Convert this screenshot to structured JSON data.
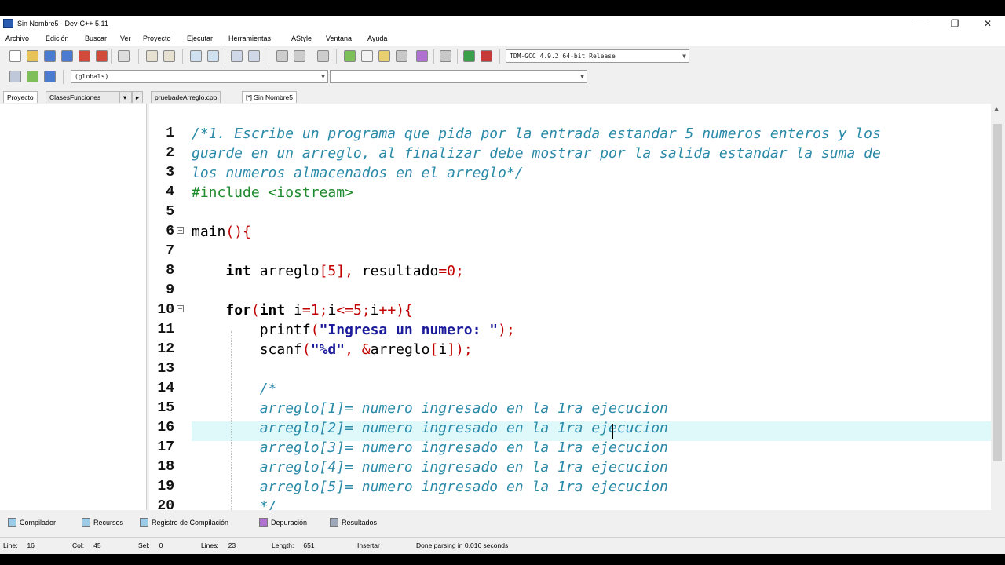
{
  "window": {
    "title": "Sin Nombre5 - Dev-C++ 5.11",
    "minimize": "—",
    "maximize": "❐",
    "close": "✕"
  },
  "menu": [
    "Archivo",
    "Edición",
    "Buscar",
    "Ver",
    "Proyecto",
    "Ejecutar",
    "Herramientas",
    "AStyle",
    "Ventana",
    "Ayuda"
  ],
  "toolbar": {
    "compiler_select": "TDM-GCC 4.9.2 64-bit Release",
    "scope_select": "(globals)",
    "function_select": ""
  },
  "left_tabs": [
    "Proyecto",
    "Clases",
    "Funciones"
  ],
  "file_tabs": [
    "pruebadeArreglo.cpp",
    "[*] Sin Nombre5"
  ],
  "code_lines": [
    "/*1. Escribe un programa que pida por la entrada estandar 5 numeros enteros y los",
    "guarde en un arreglo, al finalizar debe mostrar por la salida estandar la suma de",
    "los numeros almacenados en el arreglo*/",
    "#include <iostream>",
    "",
    "main(){",
    "",
    "    int arreglo[5], resultado=0;",
    "",
    "    for(int i=1;i<=5;i++){",
    "        printf(\"Ingresa un numero: \");",
    "        scanf(\"%d\", &arreglo[i]);",
    "",
    "        /*",
    "        arreglo[1]= numero ingresado en la 1ra ejecucion",
    "        arreglo[2]= numero ingresado en la 1ra ejecucion",
    "        arreglo[3]= numero ingresado en la 1ra ejecucion",
    "        arreglo[4]= numero ingresado en la 1ra ejecucion",
    "        arreglo[5]= numero ingresado en la 1ra ejecucion",
    "        */"
  ],
  "line_numbers": [
    "1",
    "2",
    "3",
    "4",
    "5",
    "6",
    "7",
    "8",
    "9",
    "10",
    "11",
    "12",
    "13",
    "14",
    "15",
    "16",
    "17",
    "18",
    "19",
    "20"
  ],
  "bottom_tabs": [
    "Compilador",
    "Recursos",
    "Registro de Compilación",
    "Depuración",
    "Resultados"
  ],
  "status": {
    "line_label": "Line:",
    "line": "16",
    "col_label": "Col:",
    "col": "45",
    "sel_label": "Sel:",
    "sel": "0",
    "lines_label": "Lines:",
    "lines": "23",
    "length_label": "Length:",
    "length": "651",
    "mode": "Insertar",
    "message": "Done parsing in 0.016 seconds"
  }
}
